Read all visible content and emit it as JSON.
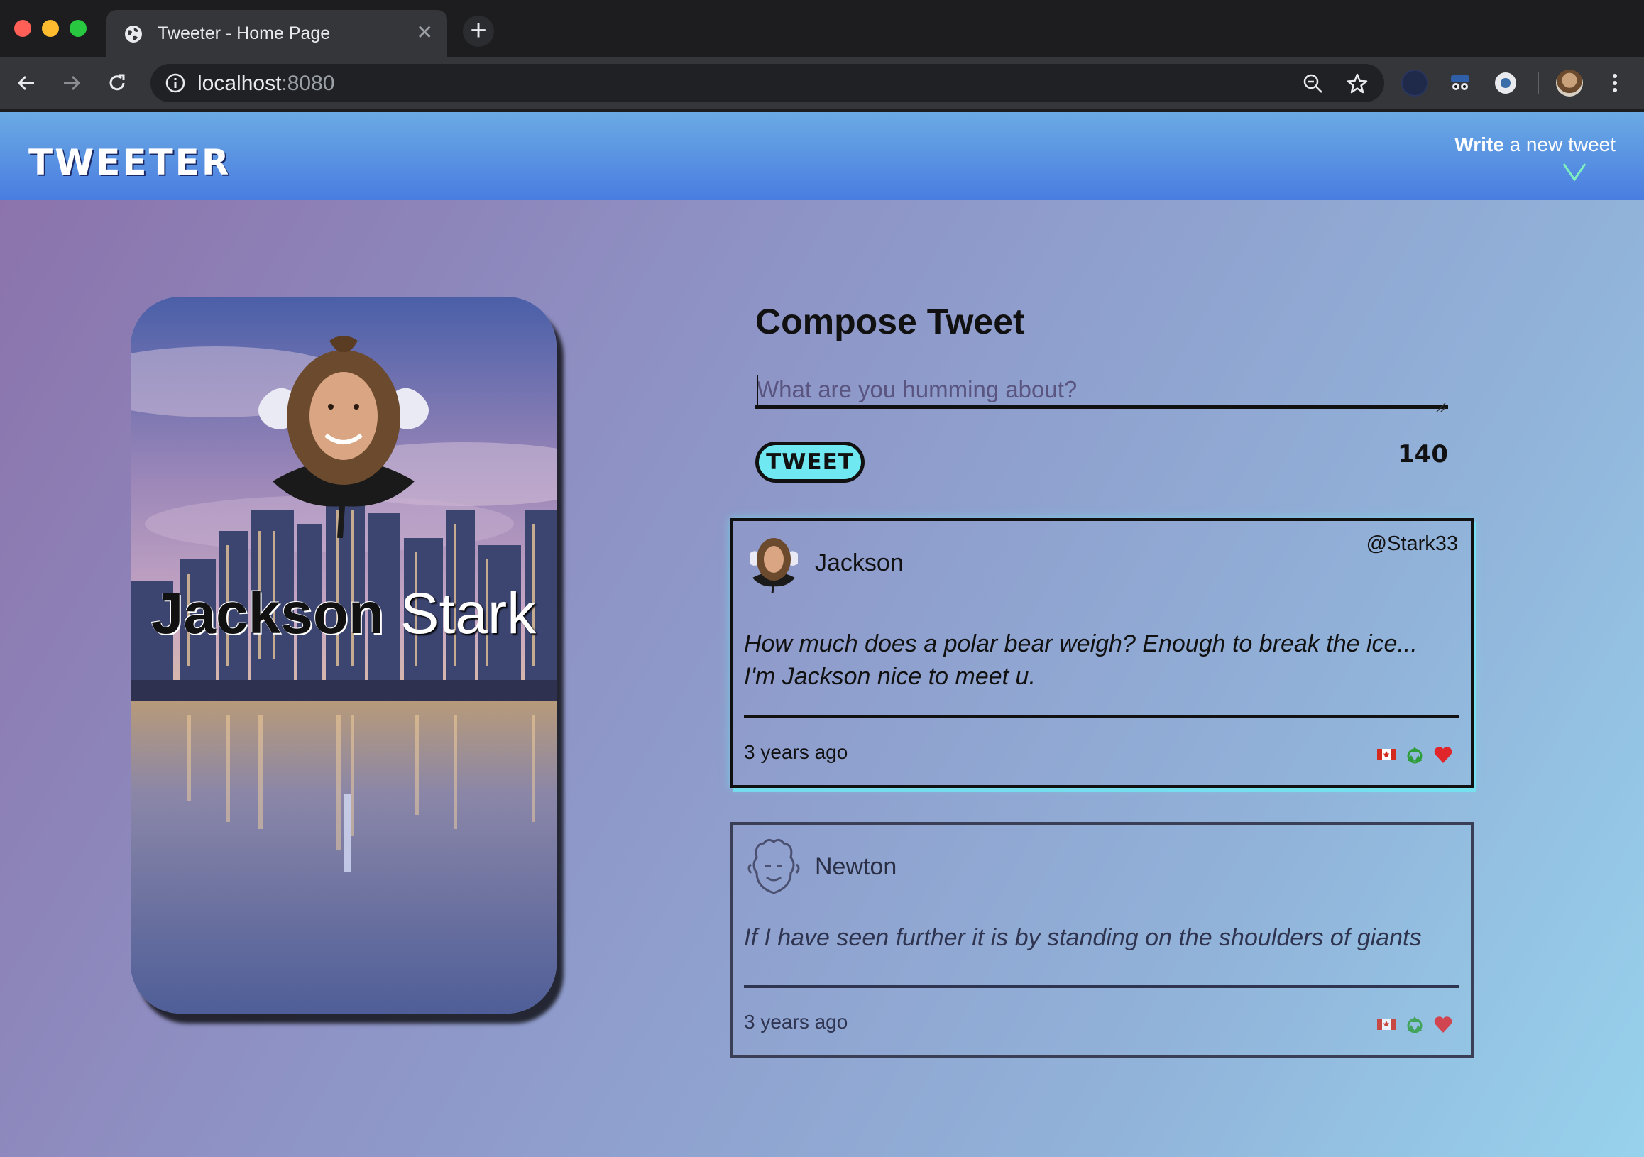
{
  "browser": {
    "tab_title": "Tweeter - Home Page",
    "url_host": "localhost",
    "url_port": ":8080"
  },
  "nav": {
    "brand": "TWEETER",
    "write_bold": "Write",
    "write_rest": " a new tweet"
  },
  "profile": {
    "first_name": "Jackson",
    "last_name": "Stark"
  },
  "compose": {
    "title": "Compose Tweet",
    "placeholder": "What are you humming about?",
    "button_label": "TWEET",
    "counter": "140"
  },
  "tweets": [
    {
      "name": "Jackson",
      "handle": "@Stark33",
      "body": "How much does a polar bear weigh? Enough to break the ice... I'm Jackson nice to meet u.",
      "time": "3 years ago",
      "actions": [
        "flag-icon",
        "retweet-icon",
        "heart-icon"
      ]
    },
    {
      "name": "Newton",
      "handle": "",
      "body": "If I have seen further it is by standing on the shoulders of giants",
      "time": "3 years ago",
      "actions": [
        "flag-icon",
        "retweet-icon",
        "heart-icon"
      ]
    }
  ],
  "colors": {
    "nav_top": "#6aaae4",
    "nav_bottom": "#4a7de0",
    "tweet_button": "#6fe8f2",
    "accent_glow": "#6fe8f2"
  }
}
